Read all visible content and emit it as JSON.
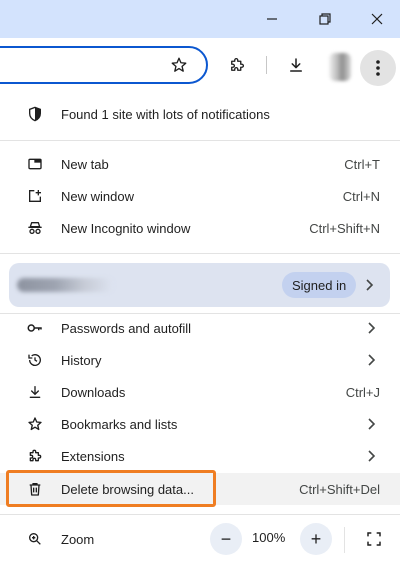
{
  "notification": {
    "label": "Found 1 site with lots of notifications",
    "icon": "shield-icon"
  },
  "items": [
    {
      "label": "New tab",
      "shortcut": "Ctrl+T",
      "icon": "new-tab-icon"
    },
    {
      "label": "New window",
      "shortcut": "Ctrl+N",
      "icon": "new-window-icon"
    },
    {
      "label": "New Incognito window",
      "shortcut": "Ctrl+Shift+N",
      "icon": "incognito-icon"
    }
  ],
  "profile": {
    "signed_in_label": "Signed in"
  },
  "nav": [
    {
      "label": "Passwords and autofill",
      "icon": "key-icon"
    },
    {
      "label": "History",
      "icon": "history-icon"
    },
    {
      "label": "Downloads",
      "shortcut": "Ctrl+J",
      "icon": "download-icon"
    },
    {
      "label": "Bookmarks and lists",
      "icon": "star-icon"
    },
    {
      "label": "Extensions",
      "icon": "puzzle-icon"
    },
    {
      "label": "Delete browsing data...",
      "shortcut": "Ctrl+Shift+Del",
      "icon": "trash-icon"
    }
  ],
  "zoom": {
    "label": "Zoom",
    "value": "100%",
    "minus": "−",
    "plus": "+"
  },
  "colors": {
    "accent": "#0b57d0",
    "highlight": "#ef7d22",
    "titlebar": "#d3e3fd",
    "profile_bg": "#dde3f0"
  }
}
